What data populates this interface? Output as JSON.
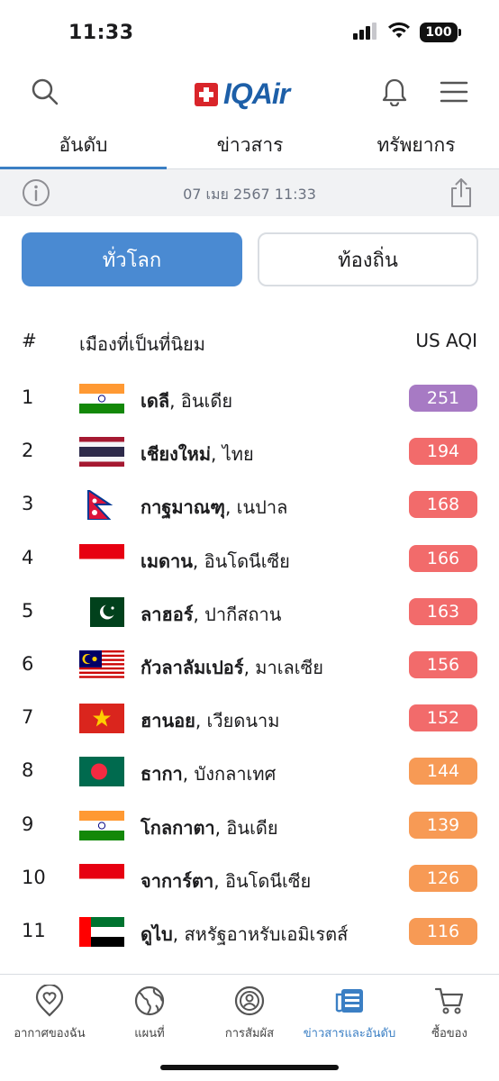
{
  "status_bar": {
    "time": "11:33",
    "battery": "100"
  },
  "header": {
    "logo_text": "IQAir"
  },
  "tabs": [
    {
      "label": "อันดับ",
      "active": true
    },
    {
      "label": "ข่าวสาร",
      "active": false
    },
    {
      "label": "ทรัพยากร",
      "active": false
    }
  ],
  "info_bar": {
    "datetime": "07 เมย 2567 11:33"
  },
  "toggle": {
    "global_label": "ทั่วโลก",
    "local_label": "ท้องถิ่น"
  },
  "table": {
    "col_rank": "#",
    "col_city": "เมืองที่เป็นที่นิยม",
    "col_aqi": "US AQI",
    "rows": [
      {
        "rank": "1",
        "city": "เดลี",
        "country": ", อินเดีย",
        "aqi": "251",
        "color": "#a77ac4",
        "flag": "india"
      },
      {
        "rank": "2",
        "city": "เชียงใหม่",
        "country": ", ไทย",
        "aqi": "194",
        "color": "#f26b6b",
        "flag": "thailand"
      },
      {
        "rank": "3",
        "city": "กาฐมาณฑุ",
        "country": ", เนปาล",
        "aqi": "168",
        "color": "#f26b6b",
        "flag": "nepal"
      },
      {
        "rank": "4",
        "city": "เมดาน",
        "country": ", อินโดนีเซีย",
        "aqi": "166",
        "color": "#f26b6b",
        "flag": "indonesia"
      },
      {
        "rank": "5",
        "city": "ลาฮอร์",
        "country": ", ปากีสถาน",
        "aqi": "163",
        "color": "#f26b6b",
        "flag": "pakistan"
      },
      {
        "rank": "6",
        "city": "กัวลาลัมเปอร์",
        "country": ", มาเลเซีย",
        "aqi": "156",
        "color": "#f26b6b",
        "flag": "malaysia"
      },
      {
        "rank": "7",
        "city": "ฮานอย",
        "country": ", เวียดนาม",
        "aqi": "152",
        "color": "#f26b6b",
        "flag": "vietnam"
      },
      {
        "rank": "8",
        "city": "ธากา",
        "country": ", บังกลาเทศ",
        "aqi": "144",
        "color": "#f79a55",
        "flag": "bangladesh"
      },
      {
        "rank": "9",
        "city": "โกลกาตา",
        "country": ", อินเดีย",
        "aqi": "139",
        "color": "#f79a55",
        "flag": "india"
      },
      {
        "rank": "10",
        "city": "จาการ์ตา",
        "country": ", อินโดนีเซีย",
        "aqi": "126",
        "color": "#f79a55",
        "flag": "indonesia"
      },
      {
        "rank": "11",
        "city": "ดูไบ",
        "country": ", สหรัฐอาหรับเอมิเรตส์",
        "aqi": "116",
        "color": "#f79a55",
        "flag": "uae"
      }
    ]
  },
  "bottom_nav": [
    {
      "label": "อากาศของฉัน",
      "icon": "heart-location-icon",
      "active": false
    },
    {
      "label": "แผนที่",
      "icon": "globe-icon",
      "active": false
    },
    {
      "label": "การสัมผัส",
      "icon": "person-circle-icon",
      "active": false
    },
    {
      "label": "ข่าวสารและอันดับ",
      "icon": "news-icon",
      "active": true
    },
    {
      "label": "ซื้อของ",
      "icon": "cart-icon",
      "active": false
    }
  ]
}
